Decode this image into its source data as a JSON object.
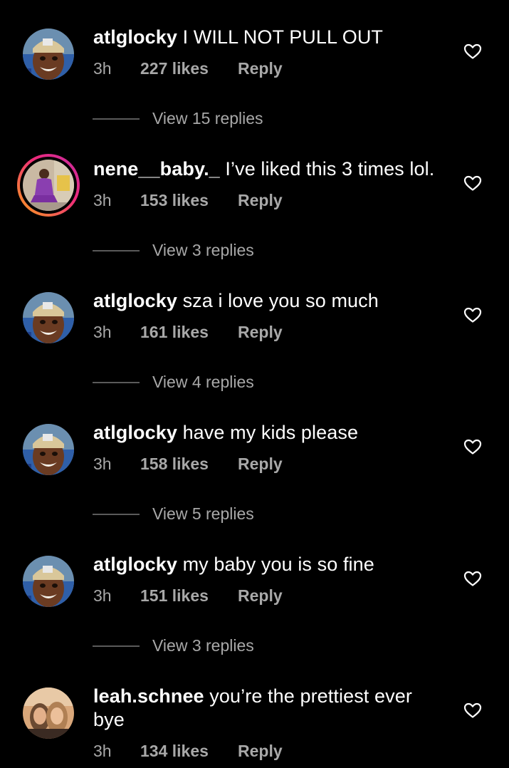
{
  "comments": [
    {
      "username": "atlglocky",
      "text": "I WILL NOT PULL OUT",
      "time": "3h",
      "likes": "227 likes",
      "reply_label": "Reply",
      "view_replies": "View 15 replies",
      "avatar": "atlglocky-avatar",
      "has_story_ring": false
    },
    {
      "username": "nene__baby._",
      "text": "I’ve liked this 3 times lol.",
      "time": "3h",
      "likes": "153 likes",
      "reply_label": "Reply",
      "view_replies": "View 3 replies",
      "avatar": "nene-avatar",
      "has_story_ring": true
    },
    {
      "username": "atlglocky",
      "text": "sza i love you so much",
      "time": "3h",
      "likes": "161 likes",
      "reply_label": "Reply",
      "view_replies": "View 4 replies",
      "avatar": "atlglocky-avatar",
      "has_story_ring": false
    },
    {
      "username": "atlglocky",
      "text": "have my kids please",
      "time": "3h",
      "likes": "158 likes",
      "reply_label": "Reply",
      "view_replies": "View 5 replies",
      "avatar": "atlglocky-avatar",
      "has_story_ring": false
    },
    {
      "username": "atlglocky",
      "text": "my baby you is so fine",
      "time": "3h",
      "likes": "151 likes",
      "reply_label": "Reply",
      "view_replies": "View 3 replies",
      "avatar": "atlglocky-avatar",
      "has_story_ring": false
    },
    {
      "username": "leah.schnee",
      "text": "you’re the prettiest ever",
      "text_line2": "bye",
      "time": "3h",
      "likes": "134 likes",
      "reply_label": "Reply",
      "avatar": "leah-avatar",
      "has_story_ring": false
    }
  ],
  "icons": {
    "like": "heart-outline-icon"
  },
  "colors": {
    "background": "#000000",
    "primary_text": "#ffffff",
    "secondary_text": "#a8a8a8",
    "divider": "#5a5a5a"
  }
}
